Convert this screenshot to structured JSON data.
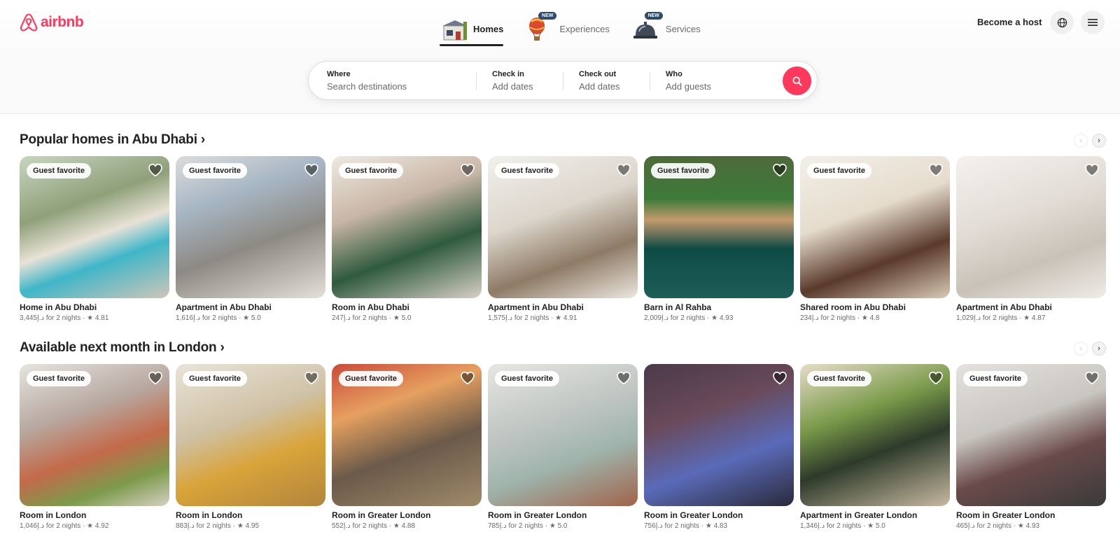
{
  "brand": {
    "name": "airbnb",
    "color": "#ff385c"
  },
  "nav": [
    {
      "label": "Homes",
      "icon": "house-icon",
      "active": true,
      "badge": ""
    },
    {
      "label": "Experiences",
      "icon": "hot-air-balloon-icon",
      "active": false,
      "badge": "NEW"
    },
    {
      "label": "Services",
      "icon": "service-bell-icon",
      "active": false,
      "badge": "NEW"
    }
  ],
  "header": {
    "host_label": "Become a host",
    "globe_icon": "globe-icon",
    "menu_icon": "menu-icon"
  },
  "search": {
    "where_title": "Where",
    "where_placeholder": "Search destinations",
    "checkin_title": "Check in",
    "checkin_value": "Add dates",
    "checkout_title": "Check out",
    "checkout_value": "Add dates",
    "who_title": "Who",
    "who_value": "Add guests",
    "button_icon": "search-icon"
  },
  "sections": [
    {
      "title": "Popular homes in Abu Dhabi ›",
      "cards": [
        {
          "title": "Home in Abu Dhabi",
          "sub": "3,445د.إ for 2 nights · ★ 4.81",
          "badge": "Guest favorite"
        },
        {
          "title": "Apartment in Abu Dhabi",
          "sub": "1,616د.إ for 2 nights · ★ 5.0",
          "badge": "Guest favorite"
        },
        {
          "title": "Room in Abu Dhabi",
          "sub": "247د.إ for 2 nights · ★ 5.0",
          "badge": "Guest favorite"
        },
        {
          "title": "Apartment in Abu Dhabi",
          "sub": "1,575د.إ for 2 nights · ★ 4.91",
          "badge": "Guest favorite"
        },
        {
          "title": "Barn in Al Rahba",
          "sub": "2,009د.إ for 2 nights · ★ 4.93",
          "badge": "Guest favorite"
        },
        {
          "title": "Shared room in Abu Dhabi",
          "sub": "234د.إ for 2 nights · ★ 4.8",
          "badge": "Guest favorite"
        },
        {
          "title": "Apartment in Abu Dhabi",
          "sub": "1,029د.إ for 2 nights · ★ 4.87",
          "badge": ""
        }
      ]
    },
    {
      "title": "Available next month in London ›",
      "cards": [
        {
          "title": "Room in London",
          "sub": "1,046د.إ for 2 nights · ★ 4.92",
          "badge": "Guest favorite"
        },
        {
          "title": "Room in London",
          "sub": "883د.إ for 2 nights · ★ 4.95",
          "badge": "Guest favorite"
        },
        {
          "title": "Room in Greater London",
          "sub": "552د.إ for 2 nights · ★ 4.88",
          "badge": "Guest favorite"
        },
        {
          "title": "Room in Greater London",
          "sub": "785د.إ for 2 nights · ★ 5.0",
          "badge": "Guest favorite"
        },
        {
          "title": "Room in Greater London",
          "sub": "756د.إ for 2 nights · ★ 4.83",
          "badge": ""
        },
        {
          "title": "Apartment in Greater London",
          "sub": "1,346د.إ for 2 nights · ★ 5.0",
          "badge": "Guest favorite"
        },
        {
          "title": "Room in Greater London",
          "sub": "465د.إ for 2 nights · ★ 4.93",
          "badge": "Guest favorite"
        }
      ]
    }
  ]
}
